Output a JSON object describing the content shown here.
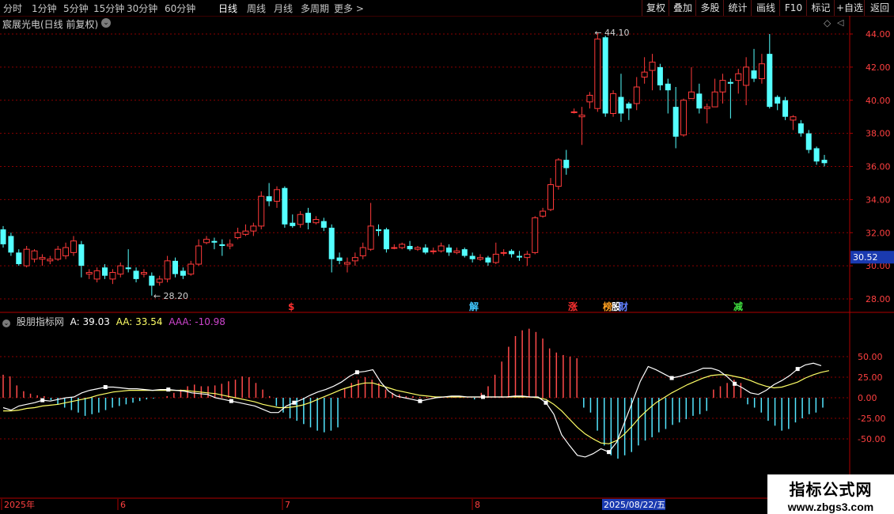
{
  "toolbar": {
    "left": [
      "分时",
      "1分钟",
      "5分钟",
      "15分钟",
      "30分钟",
      "60分钟",
      "日线",
      "周线",
      "月线",
      "多周期",
      "更多 >"
    ],
    "active": "日线",
    "right": [
      "复权",
      "叠加",
      "多股",
      "统计",
      "画线",
      "F10",
      "标记",
      "+自选",
      "返回"
    ]
  },
  "stock": {
    "title": "宸展光电(日线 前复权)"
  },
  "price_axis": {
    "ticks": [
      "44.00",
      "42.00",
      "40.00",
      "38.00",
      "36.00",
      "34.00",
      "32.00",
      "30.00",
      "28.00"
    ],
    "current_price": "30.52"
  },
  "annotations": {
    "high": "44.10",
    "low": "28.20"
  },
  "event_markers": [
    {
      "label": "$",
      "color": "#ff3030"
    },
    {
      "label": "解",
      "color": "#40c8ff"
    },
    {
      "label": "涨",
      "color": "#ff3030"
    },
    {
      "label": "榜",
      "color": "#ffa020"
    },
    {
      "label": "股",
      "color": "#ffffff"
    },
    {
      "label": "财",
      "color": "#6080ff"
    },
    {
      "label": "减",
      "color": "#40e040"
    }
  ],
  "indicator": {
    "name": "股朋指标网",
    "a_label": "A: 39.03",
    "aa_label": "AA: 33.54",
    "aaa_label": "AAA: -10.98",
    "ticks": [
      "50.00",
      "25.00",
      "0.00",
      "-25.00",
      "-50.00"
    ]
  },
  "date_axis": {
    "labels": [
      "2025年",
      "6",
      "7",
      "8"
    ],
    "cursor_date": "2025/08/22/五"
  },
  "watermark": {
    "title": "指标公式网",
    "url": "www.zbgs3.com"
  },
  "colors": {
    "up": "#ff3a3a",
    "down": "#54ffff",
    "grid": "#8b0000",
    "a_line": "#ffffff",
    "aa_line": "#ffff66",
    "aaa": "#cc44cc"
  },
  "chart_data": {
    "type": "candlestick",
    "ylim": [
      27.5,
      44.5
    ],
    "candles": [
      [
        32.2,
        31.3,
        32.4,
        31.1
      ],
      [
        31.8,
        30.8,
        32.0,
        30.6
      ],
      [
        30.8,
        30.1,
        31.0,
        30.0
      ],
      [
        30.0,
        31.0,
        31.2,
        29.9
      ],
      [
        30.4,
        30.9,
        31.0,
        30.2
      ],
      [
        30.4,
        30.5,
        30.7,
        30.0
      ],
      [
        30.3,
        30.4,
        30.6,
        30.1
      ],
      [
        30.4,
        31.0,
        31.2,
        30.3
      ],
      [
        30.6,
        31.1,
        31.4,
        30.4
      ],
      [
        30.8,
        31.5,
        31.8,
        30.6
      ],
      [
        31.3,
        30.0,
        31.5,
        29.3
      ],
      [
        29.5,
        29.6,
        29.8,
        29.2
      ],
      [
        29.2,
        29.7,
        29.9,
        29.0
      ],
      [
        29.9,
        29.4,
        30.1,
        29.2
      ],
      [
        29.2,
        29.6,
        29.8,
        28.9
      ],
      [
        29.5,
        30.0,
        30.2,
        29.3
      ],
      [
        29.9,
        29.8,
        31.0,
        29.6
      ],
      [
        29.7,
        29.2,
        29.9,
        29.0
      ],
      [
        29.5,
        29.6,
        29.8,
        29.3
      ],
      [
        29.4,
        28.8,
        29.6,
        28.2
      ],
      [
        29.0,
        29.2,
        29.4,
        28.8
      ],
      [
        29.2,
        30.3,
        30.6,
        29.0
      ],
      [
        30.3,
        29.5,
        30.5,
        29.3
      ],
      [
        29.7,
        29.4,
        29.9,
        29.2
      ],
      [
        29.5,
        30.1,
        30.3,
        29.4
      ],
      [
        30.1,
        31.2,
        31.6,
        30.0
      ],
      [
        31.4,
        31.6,
        31.8,
        31.3
      ],
      [
        31.5,
        31.4,
        31.7,
        31.0
      ],
      [
        31.3,
        31.2,
        31.6,
        30.6
      ],
      [
        31.2,
        31.3,
        31.6,
        31.0
      ],
      [
        31.7,
        32.0,
        32.3,
        31.6
      ],
      [
        31.9,
        32.1,
        32.5,
        31.8
      ],
      [
        32.1,
        32.4,
        32.6,
        31.8
      ],
      [
        32.4,
        34.2,
        34.5,
        32.2
      ],
      [
        34.2,
        33.9,
        35.0,
        33.6
      ],
      [
        33.9,
        34.6,
        34.8,
        33.5
      ],
      [
        34.7,
        32.5,
        34.8,
        32.3
      ],
      [
        32.6,
        32.4,
        33.1,
        32.3
      ],
      [
        32.5,
        33.1,
        33.3,
        32.3
      ],
      [
        33.2,
        32.6,
        33.5,
        32.2
      ],
      [
        32.6,
        32.8,
        33.0,
        32.5
      ],
      [
        32.7,
        32.3,
        32.9,
        32.1
      ],
      [
        32.3,
        30.4,
        32.5,
        29.6
      ],
      [
        30.5,
        30.3,
        30.8,
        30.1
      ],
      [
        30.1,
        30.2,
        30.5,
        29.6
      ],
      [
        30.3,
        30.5,
        30.8,
        30.0
      ],
      [
        30.6,
        31.1,
        31.4,
        30.4
      ],
      [
        31.0,
        32.4,
        33.8,
        30.9
      ],
      [
        32.2,
        32.1,
        32.5,
        31.8
      ],
      [
        32.2,
        31.0,
        32.3,
        30.8
      ],
      [
        31.1,
        31.1,
        31.3,
        31.0
      ],
      [
        31.1,
        31.3,
        31.4,
        31.0
      ],
      [
        31.2,
        31.0,
        31.5,
        30.9
      ],
      [
        31.0,
        31.1,
        31.2,
        30.9
      ],
      [
        31.1,
        30.8,
        31.3,
        30.7
      ],
      [
        30.9,
        30.9,
        31.1,
        30.7
      ],
      [
        30.9,
        31.2,
        31.4,
        30.8
      ],
      [
        31.1,
        30.8,
        31.3,
        30.6
      ],
      [
        30.8,
        30.9,
        31.1,
        30.7
      ],
      [
        31.0,
        30.6,
        31.1,
        30.5
      ],
      [
        30.6,
        30.4,
        30.8,
        30.2
      ],
      [
        30.4,
        30.5,
        30.7,
        30.3
      ],
      [
        30.5,
        30.2,
        30.6,
        30.0
      ],
      [
        30.2,
        30.7,
        31.4,
        30.1
      ],
      [
        30.8,
        30.8,
        31.0,
        30.6
      ],
      [
        30.9,
        30.7,
        31.0,
        30.5
      ],
      [
        30.6,
        30.5,
        30.9,
        30.3
      ],
      [
        30.5,
        30.7,
        30.9,
        30.0
      ],
      [
        30.8,
        32.9,
        33.0,
        30.7
      ],
      [
        33.0,
        33.3,
        33.5,
        32.9
      ],
      [
        33.4,
        34.9,
        35.3,
        33.3
      ],
      [
        34.8,
        36.4,
        36.5,
        34.6
      ],
      [
        36.4,
        35.9,
        37.0,
        35.5
      ],
      [
        39.3,
        39.3,
        39.5,
        39.2
      ],
      [
        39.0,
        39.1,
        39.6,
        37.3
      ],
      [
        39.9,
        40.3,
        40.5,
        39.5
      ],
      [
        39.5,
        43.7,
        44.1,
        39.3
      ],
      [
        43.8,
        39.2,
        43.9,
        39.0
      ],
      [
        39.2,
        40.4,
        40.6,
        39.0
      ],
      [
        40.2,
        39.2,
        41.6,
        38.7
      ],
      [
        39.8,
        39.5,
        39.9,
        38.8
      ],
      [
        39.8,
        40.8,
        41.4,
        39.4
      ],
      [
        41.4,
        41.7,
        42.6,
        41.0
      ],
      [
        41.8,
        42.3,
        42.8,
        40.6
      ],
      [
        42.0,
        40.9,
        42.2,
        40.6
      ],
      [
        41.0,
        40.6,
        41.3,
        39.2
      ],
      [
        39.6,
        37.8,
        40.8,
        37.1
      ],
      [
        37.9,
        40.0,
        40.1,
        37.8
      ],
      [
        40.1,
        40.5,
        42.0,
        40.1
      ],
      [
        40.4,
        39.5,
        41.0,
        39.2
      ],
      [
        39.5,
        39.6,
        39.8,
        38.6
      ],
      [
        39.6,
        40.5,
        41.3,
        39.6
      ],
      [
        40.5,
        41.2,
        41.6,
        39.8
      ],
      [
        41.1,
        41.0,
        41.3,
        38.9
      ],
      [
        41.2,
        41.6,
        41.9,
        40.4
      ],
      [
        40.9,
        42.0,
        42.6,
        39.7
      ],
      [
        41.8,
        41.3,
        43.1,
        41.1
      ],
      [
        41.3,
        42.2,
        42.8,
        41.0
      ],
      [
        42.8,
        39.6,
        44.0,
        39.5
      ],
      [
        40.2,
        39.8,
        40.3,
        39.4
      ],
      [
        40.0,
        39.0,
        40.2,
        38.8
      ],
      [
        38.8,
        39.0,
        39.1,
        38.2
      ],
      [
        38.6,
        38.0,
        38.8,
        37.8
      ],
      [
        38.0,
        37.0,
        38.2,
        36.8
      ],
      [
        37.1,
        36.3,
        37.2,
        36.1
      ],
      [
        36.4,
        36.2,
        36.7,
        36.0
      ]
    ],
    "indicator": {
      "ylim": [
        -85,
        85
      ],
      "a": [
        -12,
        -15,
        -10,
        -8,
        -6,
        -3,
        -4,
        -2,
        0,
        1,
        6,
        9,
        11,
        13,
        13,
        12,
        11,
        11,
        10,
        9,
        10,
        10,
        9,
        8,
        6,
        5,
        4,
        0,
        -2,
        -4,
        -6,
        -8,
        -10,
        -14,
        -18,
        -18,
        -10,
        -6,
        -2,
        3,
        7,
        10,
        14,
        19,
        26,
        31,
        32,
        34,
        19,
        8,
        2,
        0,
        -2,
        -4,
        -2,
        0,
        1,
        2,
        2,
        1,
        1,
        1,
        1,
        1,
        1,
        2,
        2,
        1,
        1,
        -6,
        -20,
        -45,
        -58,
        -70,
        -72,
        -68,
        -62,
        -66,
        -54,
        -30,
        -5,
        20,
        38,
        34,
        29,
        24,
        26,
        29,
        32,
        36,
        36,
        33,
        26,
        17,
        12,
        6,
        4,
        9,
        16,
        21,
        27,
        35,
        40,
        42,
        39
      ],
      "aa": [
        -16,
        -16,
        -15,
        -13,
        -12,
        -10,
        -9,
        -8,
        -6,
        -4,
        -2,
        0,
        3,
        5,
        7,
        8,
        9,
        9,
        9,
        9,
        9,
        9,
        9,
        9,
        8,
        7,
        6,
        5,
        3,
        1,
        -1,
        -3,
        -5,
        -8,
        -10,
        -12,
        -12,
        -11,
        -9,
        -6,
        -2,
        2,
        6,
        10,
        13,
        16,
        18,
        18,
        15,
        12,
        9,
        7,
        5,
        3,
        2,
        1,
        1,
        1,
        1,
        1,
        1,
        1,
        1,
        1,
        1,
        1,
        1,
        1,
        0,
        -2,
        -8,
        -16,
        -26,
        -36,
        -44,
        -50,
        -55,
        -56,
        -52,
        -44,
        -34,
        -23,
        -14,
        -6,
        0,
        6,
        11,
        16,
        20,
        24,
        27,
        28,
        28,
        26,
        24,
        21,
        17,
        14,
        12,
        13,
        16,
        19,
        24,
        28,
        31,
        33
      ],
      "aaa": [
        28,
        26,
        15,
        8,
        5,
        3,
        2,
        -3,
        -8,
        -12,
        -15,
        -18,
        -22,
        -20,
        -18,
        -15,
        -12,
        -10,
        -8,
        -6,
        -4,
        -2,
        -1,
        0,
        2,
        6,
        10,
        14,
        16,
        14,
        14,
        15,
        17,
        20,
        22,
        26,
        25,
        18,
        10,
        2,
        -10,
        -18,
        -25,
        -28,
        -32,
        -36,
        -40,
        -42,
        -40,
        -36,
        12,
        18,
        22,
        25,
        22,
        18,
        10,
        6,
        4,
        2,
        2,
        1,
        1,
        0,
        0,
        1,
        2,
        1,
        0,
        -2,
        6,
        14,
        28,
        44,
        62,
        75,
        82,
        84,
        80,
        72,
        60,
        55,
        52,
        50,
        48,
        -12,
        -18,
        -40,
        -58,
        -70,
        -74,
        -70,
        -66,
        -58,
        -52,
        -48,
        -42,
        -38,
        -33,
        -30,
        -26,
        -22,
        -20,
        -16,
        10,
        14,
        18,
        22,
        18,
        -8,
        -12,
        -18,
        -28,
        -34,
        -40,
        -38,
        -30,
        -25,
        -20,
        -18,
        -12
      ]
    }
  }
}
